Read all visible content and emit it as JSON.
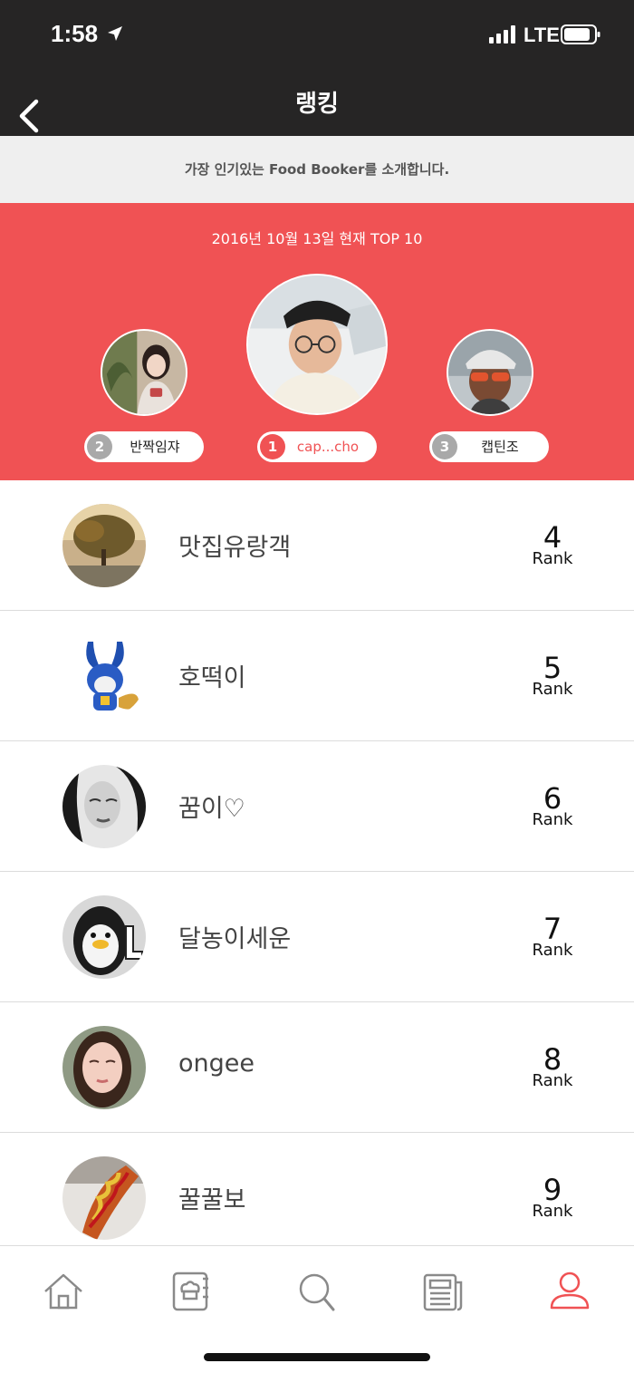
{
  "status_bar": {
    "time": "1:58",
    "network": "LTE"
  },
  "nav": {
    "title": "랭킹"
  },
  "intro": {
    "text": "가장 인기있는 Food Booker를 소개합니다."
  },
  "top3": {
    "date_label": "2016년 10월 13일 현재 TOP 10",
    "first": {
      "rank": "1",
      "name": "cap...cho"
    },
    "second": {
      "rank": "2",
      "name": "반짝임쟈"
    },
    "third": {
      "rank": "3",
      "name": "캡틴조"
    }
  },
  "ranking": [
    {
      "name": "맛집유랑객",
      "rank": "4",
      "rank_label": "Rank"
    },
    {
      "name": "호떡이",
      "rank": "5",
      "rank_label": "Rank"
    },
    {
      "name": "꿈이♡",
      "rank": "6",
      "rank_label": "Rank"
    },
    {
      "name": "달농이세운",
      "rank": "7",
      "rank_label": "Rank"
    },
    {
      "name": "ongee",
      "rank": "8",
      "rank_label": "Rank"
    },
    {
      "name": "꿀꿀보",
      "rank": "9",
      "rank_label": "Rank"
    }
  ],
  "tabs": [
    "home-icon",
    "recipe-book-icon",
    "search-icon",
    "news-icon",
    "profile-icon"
  ],
  "colors": {
    "accent": "#f05254",
    "header": "#262525",
    "tab_active": "#f05254",
    "tab_inactive": "#8a8a8a"
  }
}
